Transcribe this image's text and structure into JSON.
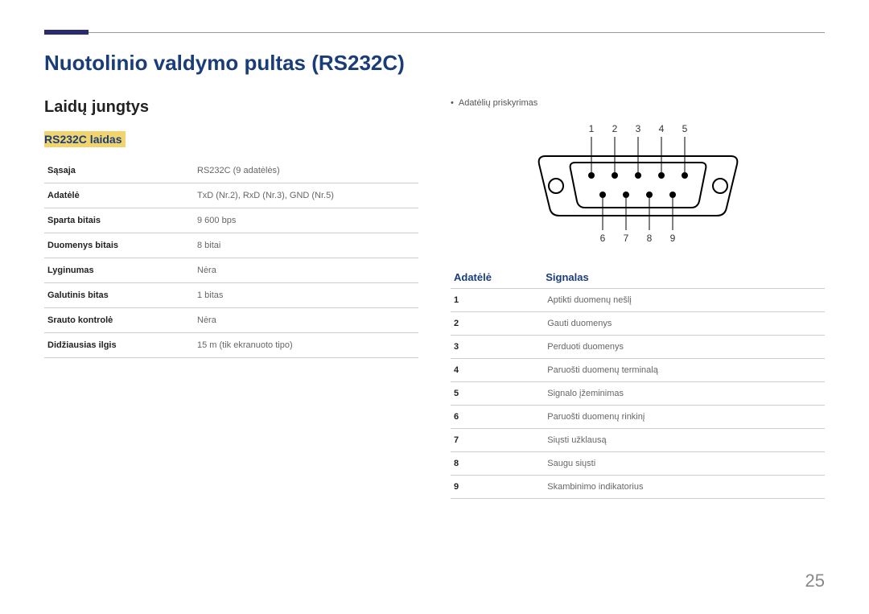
{
  "main_title": "Nuotolinio valdymo pultas (RS232C)",
  "section_title": "Laidų jungtys",
  "sub_title": "RS232C laidas",
  "spec_rows": [
    {
      "label": "Sąsaja",
      "value": "RS232C (9 adatėlės)"
    },
    {
      "label": "Adatėlė",
      "value": "TxD (Nr.2), RxD (Nr.3), GND (Nr.5)"
    },
    {
      "label": "Sparta bitais",
      "value": "9 600 bps"
    },
    {
      "label": "Duomenys bitais",
      "value": "8 bitai"
    },
    {
      "label": "Lyginumas",
      "value": "Nėra"
    },
    {
      "label": "Galutinis bitas",
      "value": "1 bitas"
    },
    {
      "label": "Srauto kontrolė",
      "value": "Nėra"
    },
    {
      "label": "Didžiausias ilgis",
      "value": "15 m (tik ekranuoto tipo)"
    }
  ],
  "pin_assignment_label": "Adatėlių priskyrimas",
  "pin_labels_top": [
    "1",
    "2",
    "3",
    "4",
    "5"
  ],
  "pin_labels_bottom": [
    "6",
    "7",
    "8",
    "9"
  ],
  "signal_header": {
    "pin": "Adatėlė",
    "signal": "Signalas"
  },
  "signal_rows": [
    {
      "pin": "1",
      "signal": "Aptikti duomenų nešlį"
    },
    {
      "pin": "2",
      "signal": "Gauti duomenys"
    },
    {
      "pin": "3",
      "signal": "Perduoti duomenys"
    },
    {
      "pin": "4",
      "signal": "Paruošti duomenų terminalą"
    },
    {
      "pin": "5",
      "signal": "Signalo įžeminimas"
    },
    {
      "pin": "6",
      "signal": "Paruošti duomenų rinkinį"
    },
    {
      "pin": "7",
      "signal": "Siųsti užklausą"
    },
    {
      "pin": "8",
      "signal": "Saugu siųsti"
    },
    {
      "pin": "9",
      "signal": "Skambinimo indikatorius"
    }
  ],
  "page_number": "25"
}
